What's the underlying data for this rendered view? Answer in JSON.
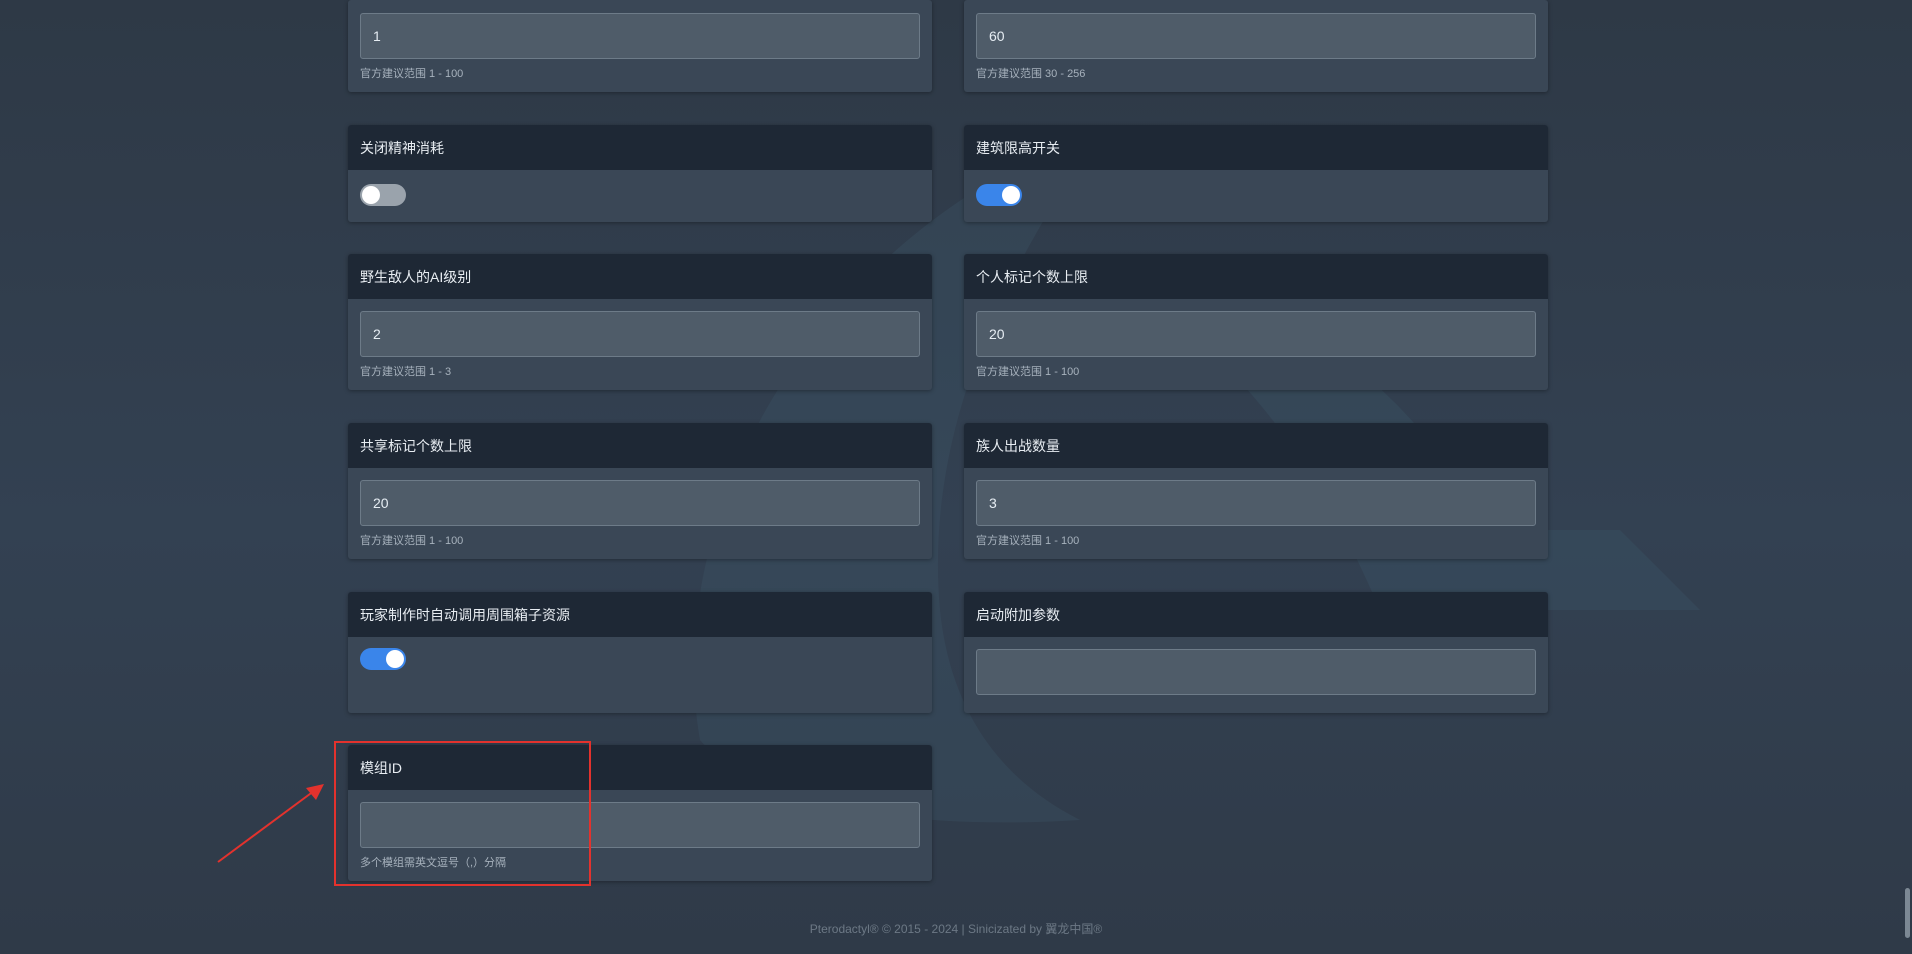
{
  "cards": {
    "top_left": {
      "value": "1",
      "hint": "官方建议范围 1 - 100"
    },
    "top_right": {
      "value": "60",
      "hint": "官方建议范围 30 - 256"
    },
    "disable_sanity": {
      "title": "关闭精神消耗",
      "toggle_state": "off"
    },
    "building_height_limit": {
      "title": "建筑限高开关",
      "toggle_state": "on"
    },
    "wild_enemy_ai": {
      "title": "野生敌人的AI级别",
      "value": "2",
      "hint": "官方建议范围 1 - 3"
    },
    "personal_markers": {
      "title": "个人标记个数上限",
      "value": "20",
      "hint": "官方建议范围 1 - 100"
    },
    "shared_markers": {
      "title": "共享标记个数上限",
      "value": "20",
      "hint": "官方建议范围 1 - 100"
    },
    "clan_battle_count": {
      "title": "族人出战数量",
      "value": "3",
      "hint": "官方建议范围 1 - 100"
    },
    "auto_use_chest_resources": {
      "title": "玩家制作时自动调用周围箱子资源",
      "toggle_state": "on"
    },
    "startup_params": {
      "title": "启动附加参数",
      "value": ""
    },
    "mod_id": {
      "title": "模组ID",
      "value": "",
      "hint": "多个模组需英文逗号（,）分隔"
    }
  },
  "footer": {
    "text": "Pterodactyl® © 2015 - 2024 | Sinicizated by 翼龙中国®"
  },
  "annotation_colors": {
    "highlight": "#e3322d",
    "toggle_on": "#3a85ea",
    "toggle_off": "#9aa3ac"
  }
}
